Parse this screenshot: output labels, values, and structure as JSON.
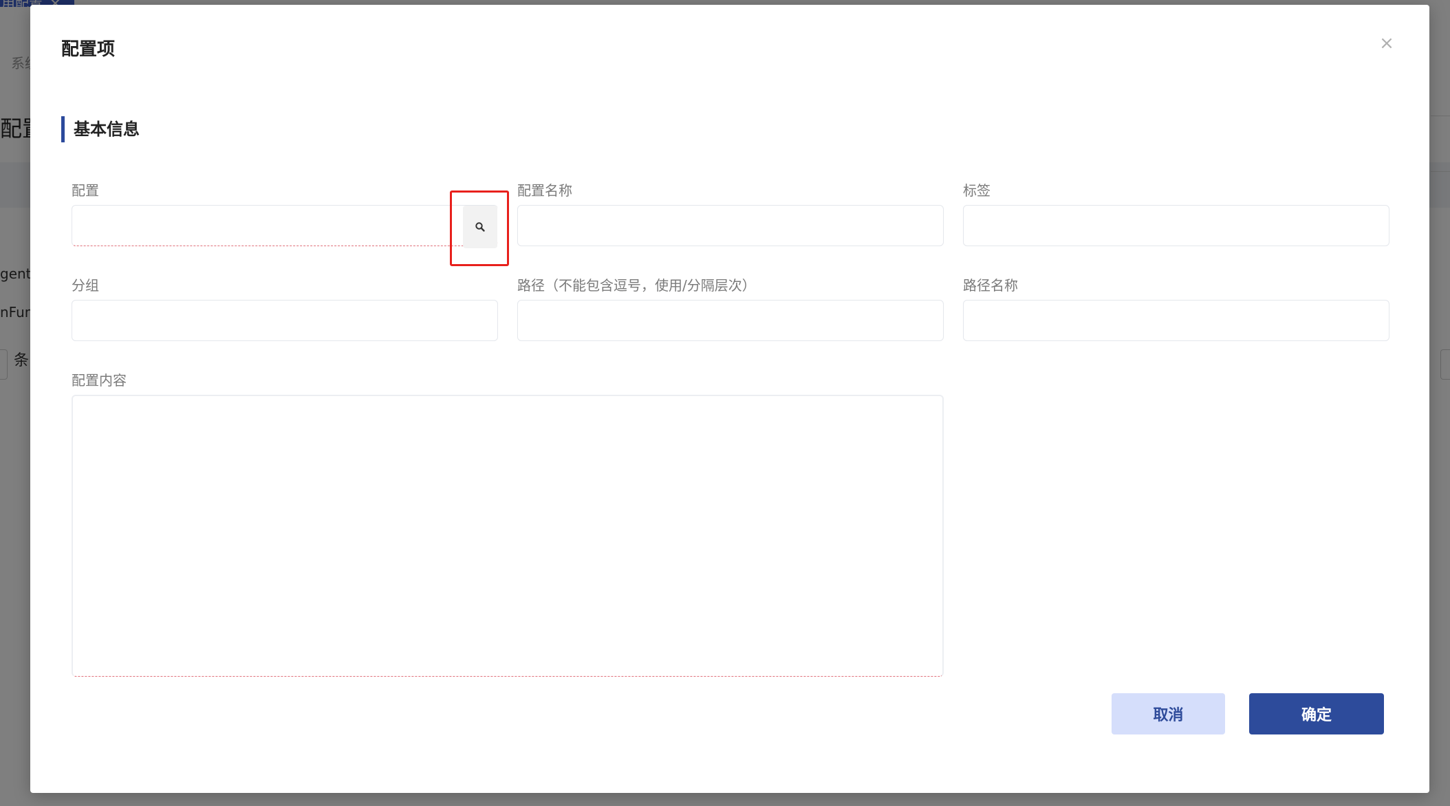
{
  "background": {
    "tab_label": "用配置",
    "tab_close": "✕",
    "breadcrumb": "系统",
    "heading": "配置",
    "row1": "gent",
    "row2": "nFun",
    "pager": "条"
  },
  "dialog": {
    "title": "配置项",
    "close": "×",
    "section_title": "基本信息",
    "fields": {
      "config": {
        "label": "配置",
        "value": ""
      },
      "config_name": {
        "label": "配置名称",
        "value": ""
      },
      "tags": {
        "label": "标签",
        "value": ""
      },
      "group": {
        "label": "分组",
        "value": ""
      },
      "path": {
        "label": "路径（不能包含逗号，使用/分隔层次）",
        "value": ""
      },
      "path_name": {
        "label": "路径名称",
        "value": ""
      },
      "content": {
        "label": "配置内容",
        "value": ""
      }
    },
    "search_icon": "search-icon",
    "buttons": {
      "cancel": "取消",
      "confirm": "确定"
    }
  },
  "colors": {
    "primary": "#2d4b9b",
    "cancel_bg": "#d5defb",
    "highlight": "#e8201c",
    "error_dash": "#e0707a"
  }
}
